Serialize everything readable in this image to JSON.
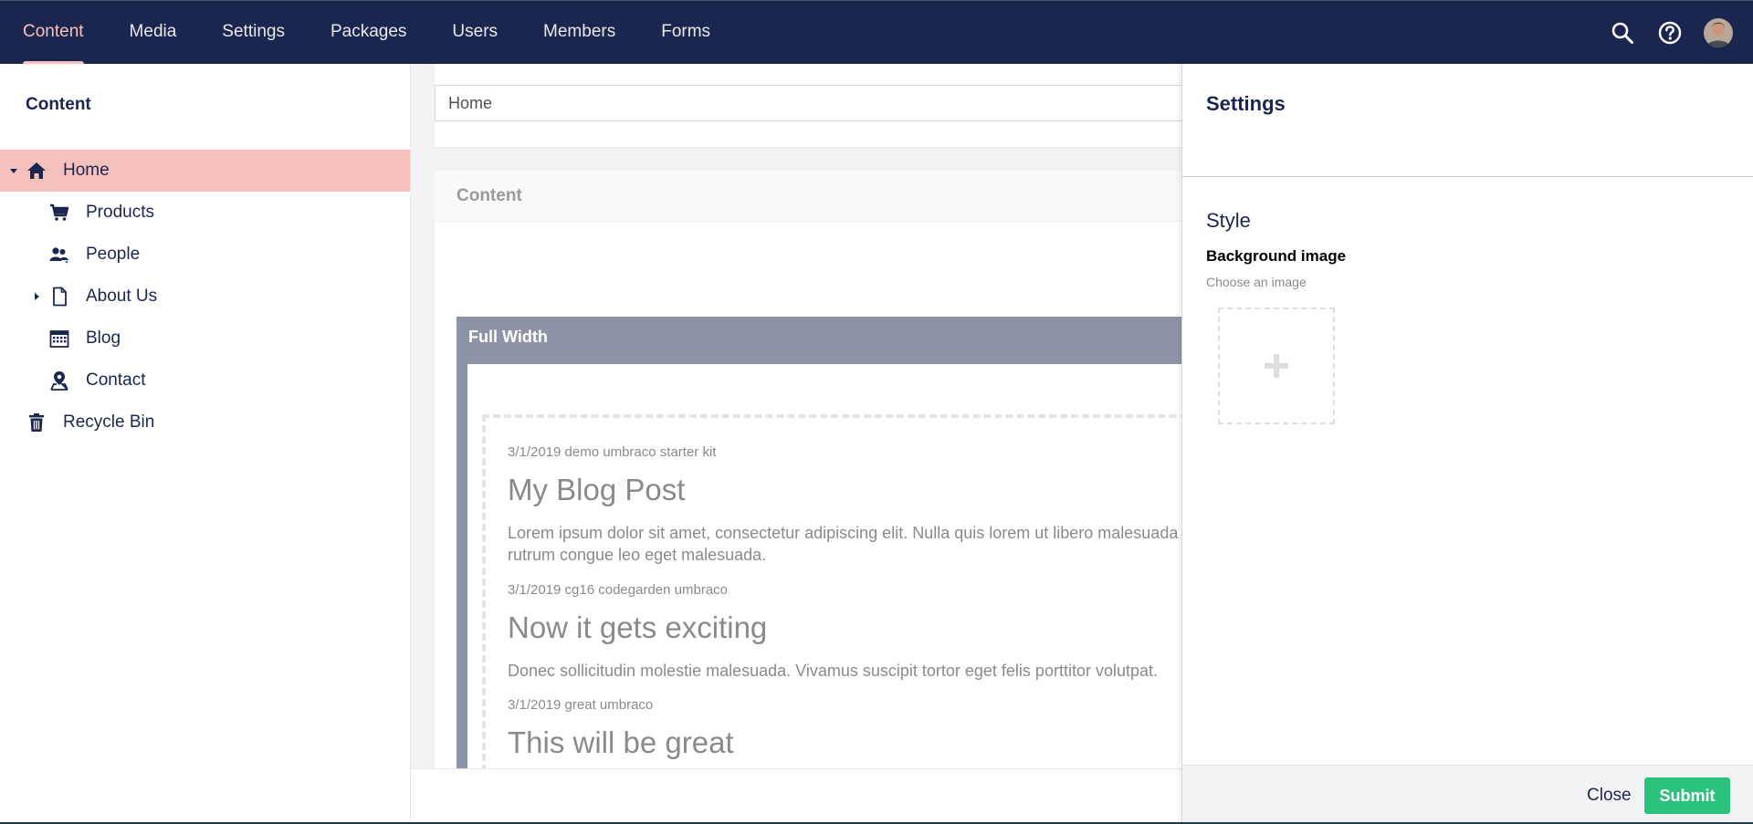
{
  "colors": {
    "nav_bg": "#1b264f",
    "nav_active": "#f5c1bc",
    "tree_selected": "#f5c1bc",
    "grid_header": "#8e94a8",
    "submit": "#2bc37c"
  },
  "topnav": {
    "items": [
      {
        "label": "Content",
        "active": true
      },
      {
        "label": "Media"
      },
      {
        "label": "Settings"
      },
      {
        "label": "Packages"
      },
      {
        "label": "Users"
      },
      {
        "label": "Members"
      },
      {
        "label": "Forms"
      }
    ],
    "icons": [
      "search-icon",
      "help-icon",
      "user-avatar"
    ]
  },
  "tree": {
    "title": "Content",
    "items": [
      {
        "label": "Home",
        "icon": "home-icon",
        "expanded": true,
        "selected": true
      },
      {
        "label": "Products",
        "icon": "cart-icon"
      },
      {
        "label": "People",
        "icon": "people-icon"
      },
      {
        "label": "About Us",
        "icon": "document-icon",
        "collapsed": true
      },
      {
        "label": "Blog",
        "icon": "calendar-icon"
      },
      {
        "label": "Contact",
        "icon": "map-pin-icon"
      },
      {
        "label": "Recycle Bin",
        "icon": "trash-icon"
      }
    ]
  },
  "editor": {
    "name_value": "Home",
    "panel_title": "Content",
    "grid_title": "Full Width",
    "posts": [
      {
        "meta": "3/1/2019 demo umbraco starter kit",
        "title": "My Blog Post",
        "text": "Lorem ipsum dolor sit amet, consectetur adipiscing elit. Nulla quis lorem ut libero malesuada",
        "text2": "rutrum congue leo eget malesuada."
      },
      {
        "meta": "3/1/2019 cg16 codegarden umbraco",
        "title": "Now it gets exciting",
        "text": "Donec sollicitudin molestie malesuada. Vivamus suscipit tortor eget felis porttitor volutpat."
      },
      {
        "meta": "3/1/2019 great umbraco",
        "title": "This will be great"
      }
    ]
  },
  "settings": {
    "title": "Settings",
    "section": "Style",
    "field_label": "Background image",
    "field_desc": "Choose an image",
    "close_label": "Close",
    "submit_label": "Submit"
  }
}
